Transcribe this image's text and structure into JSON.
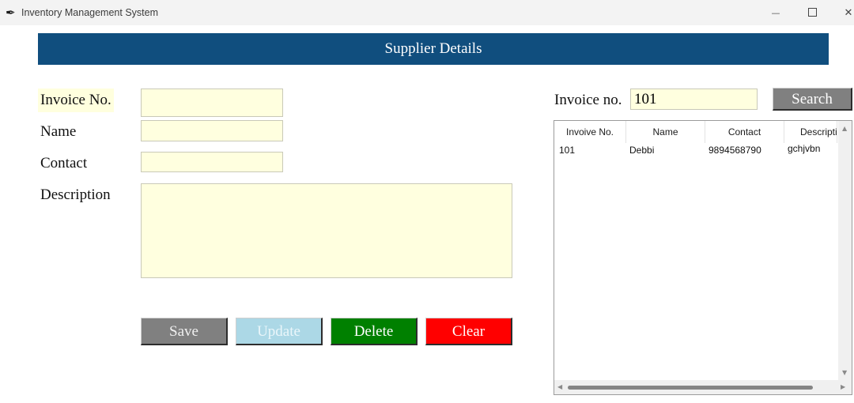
{
  "window": {
    "title": "Inventory Management System",
    "icon": "feather-icon",
    "minimize": "—",
    "close": "✕"
  },
  "header": {
    "title": "Supplier Details"
  },
  "form": {
    "invoice_label": "Invoice No.",
    "name_label": "Name",
    "contact_label": "Contact",
    "description_label": "Description",
    "invoice_value": "",
    "name_value": "",
    "contact_value": "",
    "description_value": ""
  },
  "buttons": {
    "save": "Save",
    "update": "Update",
    "delete": "Delete",
    "clear": "Clear"
  },
  "search": {
    "label": "Invoice no.",
    "value": "101",
    "button": "Search"
  },
  "table": {
    "columns": [
      "Invoive No.",
      "Name",
      "Contact",
      "Descripti"
    ],
    "rows": [
      [
        "101",
        "Debbi",
        "9894568790",
        "gchjvbn"
      ]
    ]
  },
  "colors": {
    "header_bg": "#104e7e",
    "field_bg": "#ffffdf",
    "save": "#808080",
    "update": "#acd8e6",
    "delete": "#008000",
    "clear": "#ff0000",
    "search": "#808080"
  }
}
